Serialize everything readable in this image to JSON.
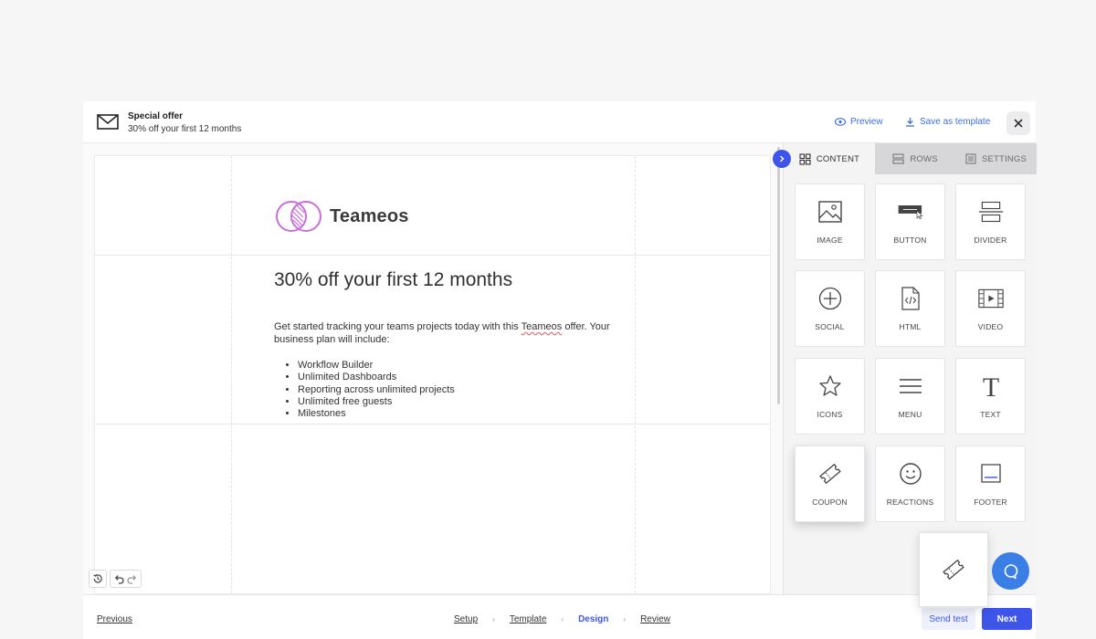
{
  "header": {
    "title": "Special offer",
    "subtitle": "30% off your first 12 months",
    "preview_label": "Preview",
    "save_template_label": "Save as template",
    "icons": {
      "envelope": "envelope-icon",
      "eye": "eye-icon",
      "download": "download-icon",
      "close": "close-icon"
    }
  },
  "email": {
    "logo_word": "Teameos",
    "headline": "30% off your first 12 months",
    "body_before": "Get started tracking your teams projects today with this ",
    "body_brand": "Teameos",
    "body_after": " offer. Your business plan will include:",
    "features": [
      "Workflow Builder",
      "Unlimited Dashboards",
      "Reporting across unlimited projects",
      "Unlimited free guests",
      "Milestones"
    ]
  },
  "panel": {
    "tabs": [
      {
        "label": "CONTENT",
        "icon": "grid-icon",
        "active": true
      },
      {
        "label": "ROWS",
        "icon": "rows-icon",
        "active": false
      },
      {
        "label": "SETTINGS",
        "icon": "settings-icon",
        "active": false
      }
    ],
    "tiles": [
      {
        "label": "IMAGE",
        "icon": "image-icon"
      },
      {
        "label": "BUTTON",
        "icon": "button-icon"
      },
      {
        "label": "DIVIDER",
        "icon": "divider-icon"
      },
      {
        "label": "SOCIAL",
        "icon": "social-icon"
      },
      {
        "label": "HTML",
        "icon": "html-icon"
      },
      {
        "label": "VIDEO",
        "icon": "video-icon"
      },
      {
        "label": "ICONS",
        "icon": "star-icon"
      },
      {
        "label": "MENU",
        "icon": "menu-icon"
      },
      {
        "label": "TEXT",
        "icon": "text-icon"
      },
      {
        "label": "COUPON",
        "icon": "coupon-icon"
      },
      {
        "label": "REACTIONS",
        "icon": "smiley-icon"
      },
      {
        "label": "FOOTER",
        "icon": "footer-icon"
      }
    ]
  },
  "footer": {
    "previous_label": "Previous",
    "steps": [
      "Setup",
      "Template",
      "Design",
      "Review"
    ],
    "current_step": "Design",
    "send_test_label": "Send test",
    "next_label": "Next"
  },
  "colors": {
    "accent": "#3d55e8",
    "link": "#3d6fe0",
    "logo": "#c86fd9",
    "chat": "#3b7fe6"
  }
}
